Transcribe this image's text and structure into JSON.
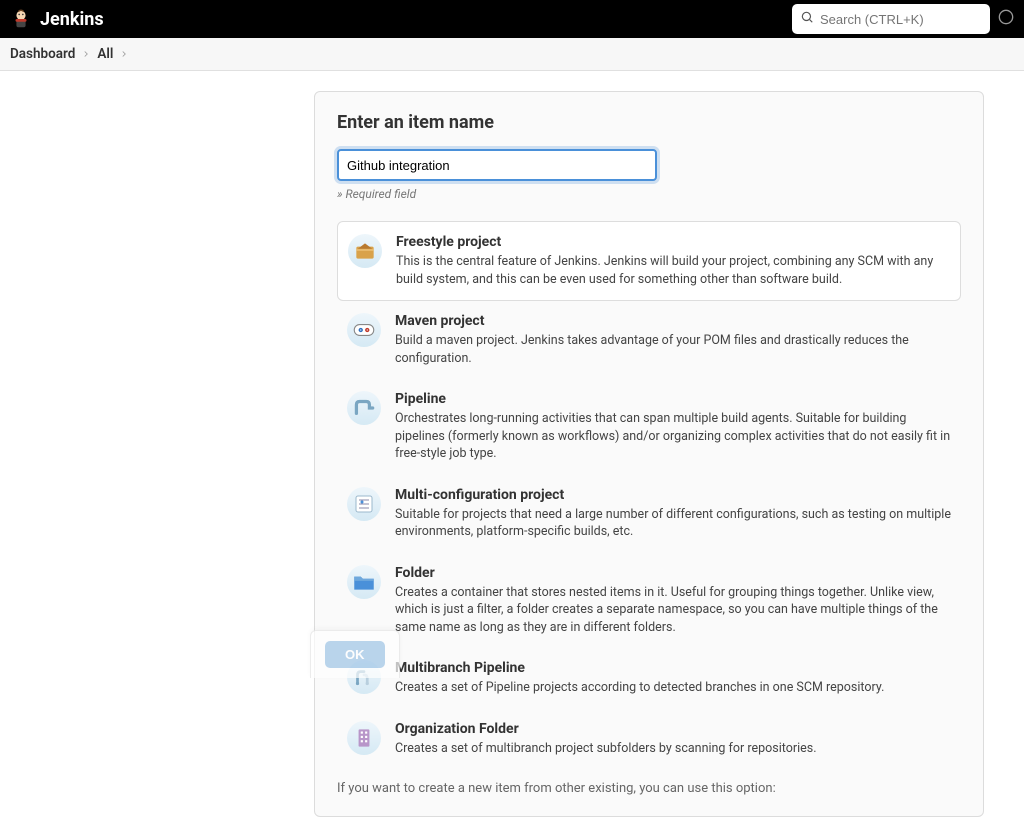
{
  "header": {
    "brand": "Jenkins",
    "search_placeholder": "Search (CTRL+K)"
  },
  "breadcrumbs": {
    "items": [
      "Dashboard",
      "All"
    ]
  },
  "form": {
    "title": "Enter an item name",
    "name_value": "Github integration",
    "required_hint": "» Required field",
    "copy_hint": "If you want to create a new item from other existing, you can use this option:"
  },
  "types": [
    {
      "id": "freestyle",
      "title": "Freestyle project",
      "desc": "This is the central feature of Jenkins. Jenkins will build your project, combining any SCM with any build system, and this can be even used for something other than software build."
    },
    {
      "id": "maven",
      "title": "Maven project",
      "desc": "Build a maven project. Jenkins takes advantage of your POM files and drastically reduces the configuration."
    },
    {
      "id": "pipeline",
      "title": "Pipeline",
      "desc": "Orchestrates long-running activities that can span multiple build agents. Suitable for building pipelines (formerly known as workflows) and/or organizing complex activities that do not easily fit in free-style job type."
    },
    {
      "id": "multiconfig",
      "title": "Multi-configuration project",
      "desc": "Suitable for projects that need a large number of different configurations, such as testing on multiple environments, platform-specific builds, etc."
    },
    {
      "id": "folder",
      "title": "Folder",
      "desc": "Creates a container that stores nested items in it. Useful for grouping things together. Unlike view, which is just a filter, a folder creates a separate namespace, so you can have multiple things of the same name as long as they are in different folders."
    },
    {
      "id": "multibranch",
      "title": "Multibranch Pipeline",
      "desc": "Creates a set of Pipeline projects according to detected branches in one SCM repository."
    },
    {
      "id": "orgfolder",
      "title": "Organization Folder",
      "desc": "Creates a set of multibranch project subfolders by scanning for repositories."
    }
  ],
  "ok_button": "OK"
}
